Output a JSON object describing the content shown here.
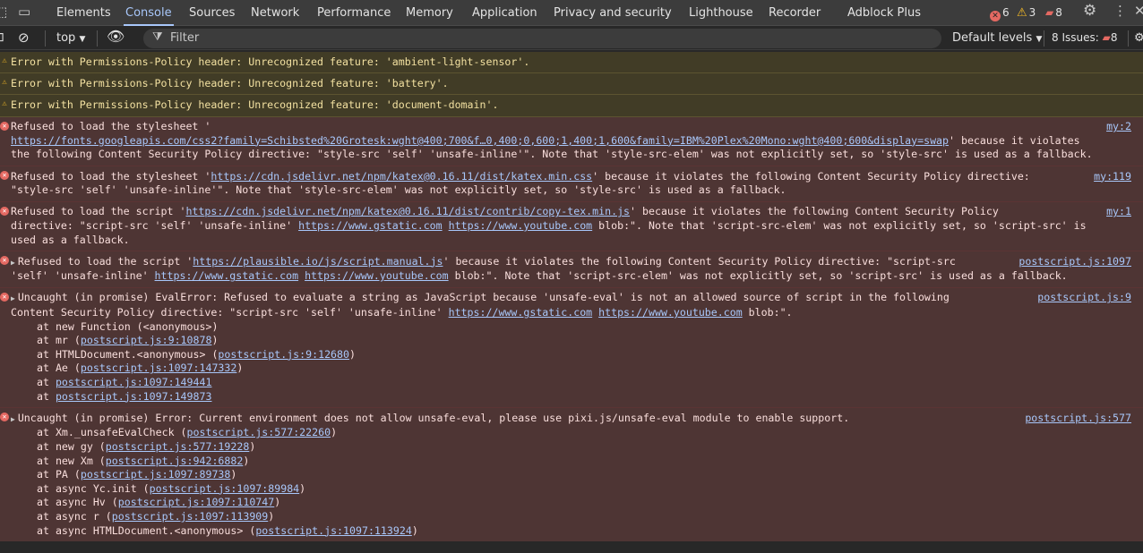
{
  "tabs": [
    {
      "label": "Elements"
    },
    {
      "label": "Console"
    },
    {
      "label": "Sources"
    },
    {
      "label": "Network"
    },
    {
      "label": "Performance"
    },
    {
      "label": "Memory"
    },
    {
      "label": "Application"
    },
    {
      "label": "Privacy and security"
    },
    {
      "label": "Lighthouse"
    },
    {
      "label": "Recorder"
    },
    {
      "label": "Adblock Plus"
    }
  ],
  "counters": {
    "errors": "6",
    "warnings": "3",
    "issues": "8"
  },
  "toolbar": {
    "context": "top",
    "filter_placeholder": "Filter",
    "levels": "Default levels",
    "issues_label": "8 Issues:",
    "issues_count": "8"
  },
  "messages": [
    {
      "level": "warning",
      "text": "Error with Permissions-Policy header: Unrecognized feature: 'ambient-light-sensor'."
    },
    {
      "level": "warning",
      "text": "Error with Permissions-Policy header: Unrecognized feature: 'battery'."
    },
    {
      "level": "warning",
      "text": "Error with Permissions-Policy header: Unrecognized feature: 'document-domain'."
    },
    {
      "level": "error",
      "source": "my:2",
      "p1": "Refused to load the stylesheet '\n",
      "url1": "https://fonts.googleapis.com/css2?family=Schibsted%20Grotesk:wght@400;700&f…0,400;0,600;1,400;1,600&family=IBM%20Plex%20Mono:wght@400;600&display=swap",
      "p2": "' because it violates\nthe following Content Security Policy directive: \"style-src 'self' 'unsafe-inline'\". Note that 'style-src-elem' was not explicitly set, so 'style-src' is used as a fallback."
    },
    {
      "level": "error",
      "source": "my:119",
      "p1": "Refused to load the stylesheet '",
      "url1": "https://cdn.jsdelivr.net/npm/katex@0.16.11/dist/katex.min.css",
      "p2": "' because it violates the following Content Security Policy directive:\n\"style-src 'self' 'unsafe-inline'\". Note that 'style-src-elem' was not explicitly set, so 'style-src' is used as a fallback."
    },
    {
      "level": "error",
      "source": "my:1",
      "p1": "Refused to load the script '",
      "url1": "https://cdn.jsdelivr.net/npm/katex@0.16.11/dist/contrib/copy-tex.min.js",
      "p2": "' because it violates the following Content Security Policy\ndirective: \"script-src 'self' 'unsafe-inline' ",
      "url2": "https://www.gstatic.com",
      "p3": " ",
      "url3": "https://www.youtube.com",
      "p4": " blob:\". Note that 'script-src-elem' was not explicitly set, so 'script-src' is\nused as a fallback."
    },
    {
      "level": "error",
      "source": "postscript.js:1097",
      "p1": "Refused to load the script '",
      "url1": "https://plausible.io/js/script.manual.js",
      "p2": "' because it violates the following Content Security Policy directive: \"script-src\n'self' 'unsafe-inline' ",
      "url2": "https://www.gstatic.com",
      "p3": " ",
      "url3": "https://www.youtube.com",
      "p4": " blob:\". Note that 'script-src-elem' was not explicitly set, so 'script-src' is used as a fallback."
    },
    {
      "level": "error",
      "source": "postscript.js:9",
      "p1": "Uncaught (in promise) EvalError: Refused to evaluate a string as JavaScript because 'unsafe-eval' is not an allowed source of script in the following\nContent Security Policy directive: \"script-src 'self' 'unsafe-inline' ",
      "url1": "https://www.gstatic.com",
      "p2": " ",
      "url2": "https://www.youtube.com",
      "p3": " blob:\".\n",
      "frames": [
        {
          "pre": "at new Function (<anonymous>)",
          "link": "",
          "post": ""
        },
        {
          "pre": "at mr (",
          "link": "postscript.js:9:10878",
          "post": ")"
        },
        {
          "pre": "at HTMLDocument.<anonymous> (",
          "link": "postscript.js:9:12680",
          "post": ")"
        },
        {
          "pre": "at Ae (",
          "link": "postscript.js:1097:147332",
          "post": ")"
        },
        {
          "pre": "at ",
          "link": "postscript.js:1097:149441",
          "post": ""
        },
        {
          "pre": "at ",
          "link": "postscript.js:1097:149873",
          "post": ""
        }
      ]
    },
    {
      "level": "error",
      "source": "postscript.js:577",
      "p1": "Uncaught (in promise) Error: Current environment does not allow unsafe-eval, please use pixi.js/unsafe-eval module to enable support.",
      "frames": [
        {
          "pre": "at Xm._unsafeEvalCheck (",
          "link": "postscript.js:577:22260",
          "post": ")"
        },
        {
          "pre": "at new gy (",
          "link": "postscript.js:577:19228",
          "post": ")"
        },
        {
          "pre": "at new Xm (",
          "link": "postscript.js:942:6882",
          "post": ")"
        },
        {
          "pre": "at PA (",
          "link": "postscript.js:1097:89738",
          "post": ")"
        },
        {
          "pre": "at async Yc.init (",
          "link": "postscript.js:1097:89984",
          "post": ")"
        },
        {
          "pre": "at async Hv (",
          "link": "postscript.js:1097:110747",
          "post": ")"
        },
        {
          "pre": "at async r (",
          "link": "postscript.js:1097:113909",
          "post": ")"
        },
        {
          "pre": "at async HTMLDocument.<anonymous> (",
          "link": "postscript.js:1097:113924",
          "post": ")"
        }
      ]
    }
  ],
  "colors": {
    "error": "#e46962",
    "warning": "#f9bd25",
    "accent": "#a8c7fa"
  }
}
